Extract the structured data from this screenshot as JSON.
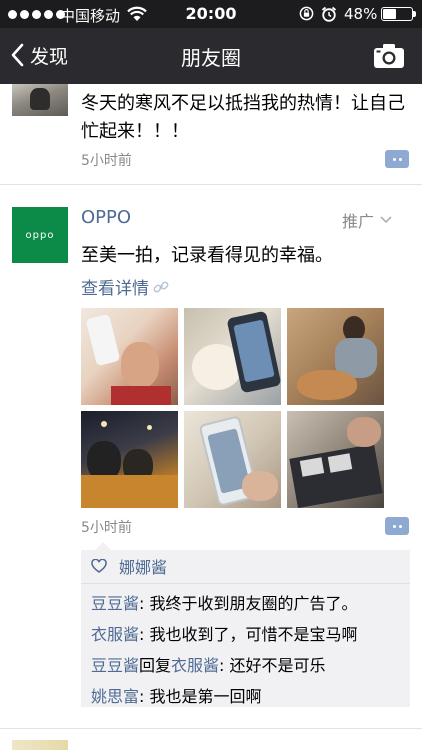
{
  "status_bar": {
    "carrier": "中国移动",
    "time": "20:00",
    "battery_percent": "48%",
    "battery_level": 0.48
  },
  "nav": {
    "back_label": "发现",
    "title": "朋友圈"
  },
  "posts": [
    {
      "text": "冬天的寒风不足以抵挡我的热情！让自己忙起来！！！",
      "time": "5小时前"
    },
    {
      "author": "OPPO",
      "avatar_text": "oppo",
      "promo_label": "推广",
      "text": "至美一拍，记录看得见的幸福。",
      "link_label": "查看详情",
      "time": "5小时前",
      "likes": [
        "娜娜酱"
      ],
      "comments": [
        {
          "author": "豆豆酱",
          "text": "我终于收到朋友圈的广告了。"
        },
        {
          "author": "衣服酱",
          "text": "我也收到了，可惜不是宝马啊"
        },
        {
          "author": "豆豆酱",
          "reply_word": "回复",
          "reply_to": "衣服酱",
          "text": "还好不是可乐"
        },
        {
          "author": "姚思富",
          "text": "我也是第一回啊"
        }
      ]
    }
  ],
  "colors": {
    "link_blue": "#4f6b94",
    "oppo_green": "#0c8a47",
    "navbar": "#2b2b2f",
    "comment_bg": "#f1f1f3"
  }
}
